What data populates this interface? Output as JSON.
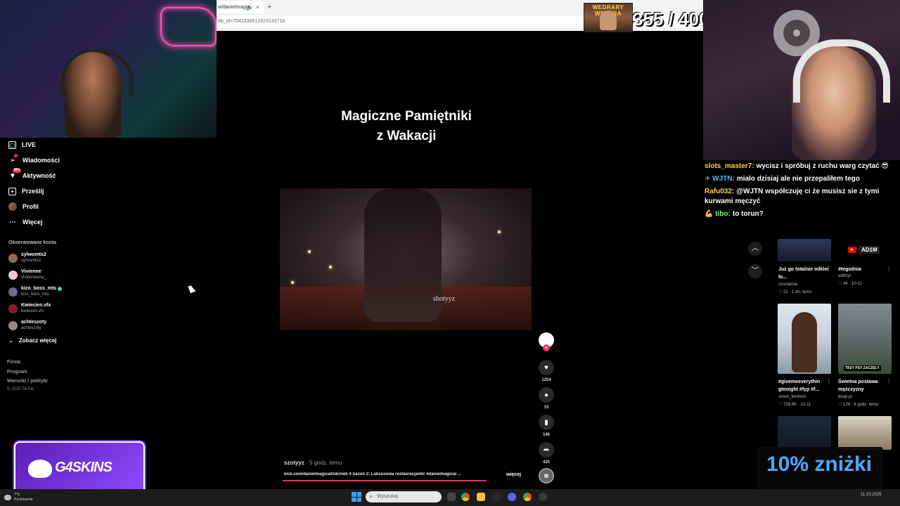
{
  "browser": {
    "tab_title": "w/danielmagic",
    "tab_close": "×",
    "new_tab": "+",
    "url": "eb_id=754233651282313371​8"
  },
  "overlay": {
    "counter_img_label": "WEDRARY WEZARA",
    "counter": "355 / 400"
  },
  "nav": {
    "items": [
      {
        "label": "LIVE",
        "icon": "live-tv-icon"
      },
      {
        "label": "Wiadomości",
        "icon": "send-icon"
      },
      {
        "label": "Aktywność",
        "icon": "activity-icon",
        "badge": "99+"
      },
      {
        "label": "Prześlij",
        "icon": "upload-icon"
      },
      {
        "label": "Profil",
        "icon": "profile-avatar"
      },
      {
        "label": "Więcej",
        "icon": "more-icon"
      }
    ],
    "following_title": "Obserwowane konta",
    "following": [
      {
        "name": "sylwomts2",
        "handle": "sylwomts2",
        "color": "#8a6a5a"
      },
      {
        "name": "Vivienne",
        "handle": "vivienneana_",
        "color": "#f5c6d8"
      },
      {
        "name": "kizo_boss_mts",
        "handle": "kizo_boss_mts",
        "color": "#6a6a8a",
        "verified": true
      },
      {
        "name": "Kwiecien.vfx",
        "handle": "kwiecien.vfx",
        "color": "#8a1a2a"
      },
      {
        "name": "achteszoty",
        "handle": "achteszoty",
        "color": "#9a8a7a"
      }
    ],
    "see_more": "Zobacz więcej",
    "footer": [
      "Firma",
      "Program",
      "Warunki i polityki"
    ],
    "copyright": "© 2025 TikTok"
  },
  "video": {
    "title_line1": "Magiczne Pamiętniki",
    "title_line2": "z Wakacji",
    "watermark": "shotyyz",
    "author": "szotyyz",
    "time": " · 5 godz. temu",
    "description": "kick.com/danielmagicalOdcinek 4 Sezon 2: Luksusowa restauracja#dc #danielmagical ...",
    "more": "więcej",
    "progress": 1.0
  },
  "actions": {
    "likes": "1254",
    "comments": "15",
    "saves": "146",
    "shares": "425"
  },
  "chat": [
    {
      "user": "slots_master7:",
      "color": "#ffd447",
      "text": "wycisz i spróbuj z ruchu warg czytać 😎"
    },
    {
      "user": "✈ WJTN:",
      "color": "#57b4ff",
      "text": "mialo dzisiaj ale nie przepaliłem tego"
    },
    {
      "user": "Rafu032:",
      "color": "#ffd447",
      "text": "@WJTN współczuję ci że musisz sie z tymi kurwami męczyć"
    },
    {
      "user": "💪 tibo:",
      "color": "#7bff6a",
      "text": "to torun?"
    }
  ],
  "cards": [
    {
      "title": "Już go totalnie odklei​ło...",
      "user": "szoclarnia",
      "meta": "♡ 22  · 1 dn. temu"
    },
    {
      "title": "#tegodnia",
      "user": "adfmyt",
      "meta": "♡ 44  · 10-11"
    },
    {
      "title": "#givemeeverythin gtonight #fyp #f...",
      "user": "street_fetchers",
      "meta": "♡ 728.9K · 10-11"
    },
    {
      "title": "Świetna postawa mężczyzny",
      "user": "boop.pl",
      "meta": "♡ 126  · 6 godz. temu",
      "thumb_label": "TRZY PSY ZACZĘŁY"
    }
  ],
  "yt_badge": "AD1M",
  "discount": "10% zniżki",
  "sponsor": "G4SKINS",
  "taskbar": {
    "weather_line1": "7°C",
    "weather_line2": "Pochmurnie",
    "search_placeholder": "Wyszukaj",
    "clock": "11.10.2025"
  },
  "colors": {
    "accent": "#fe2c55",
    "discount": "#4aa8ff",
    "sponsor": "#7a2cff"
  }
}
